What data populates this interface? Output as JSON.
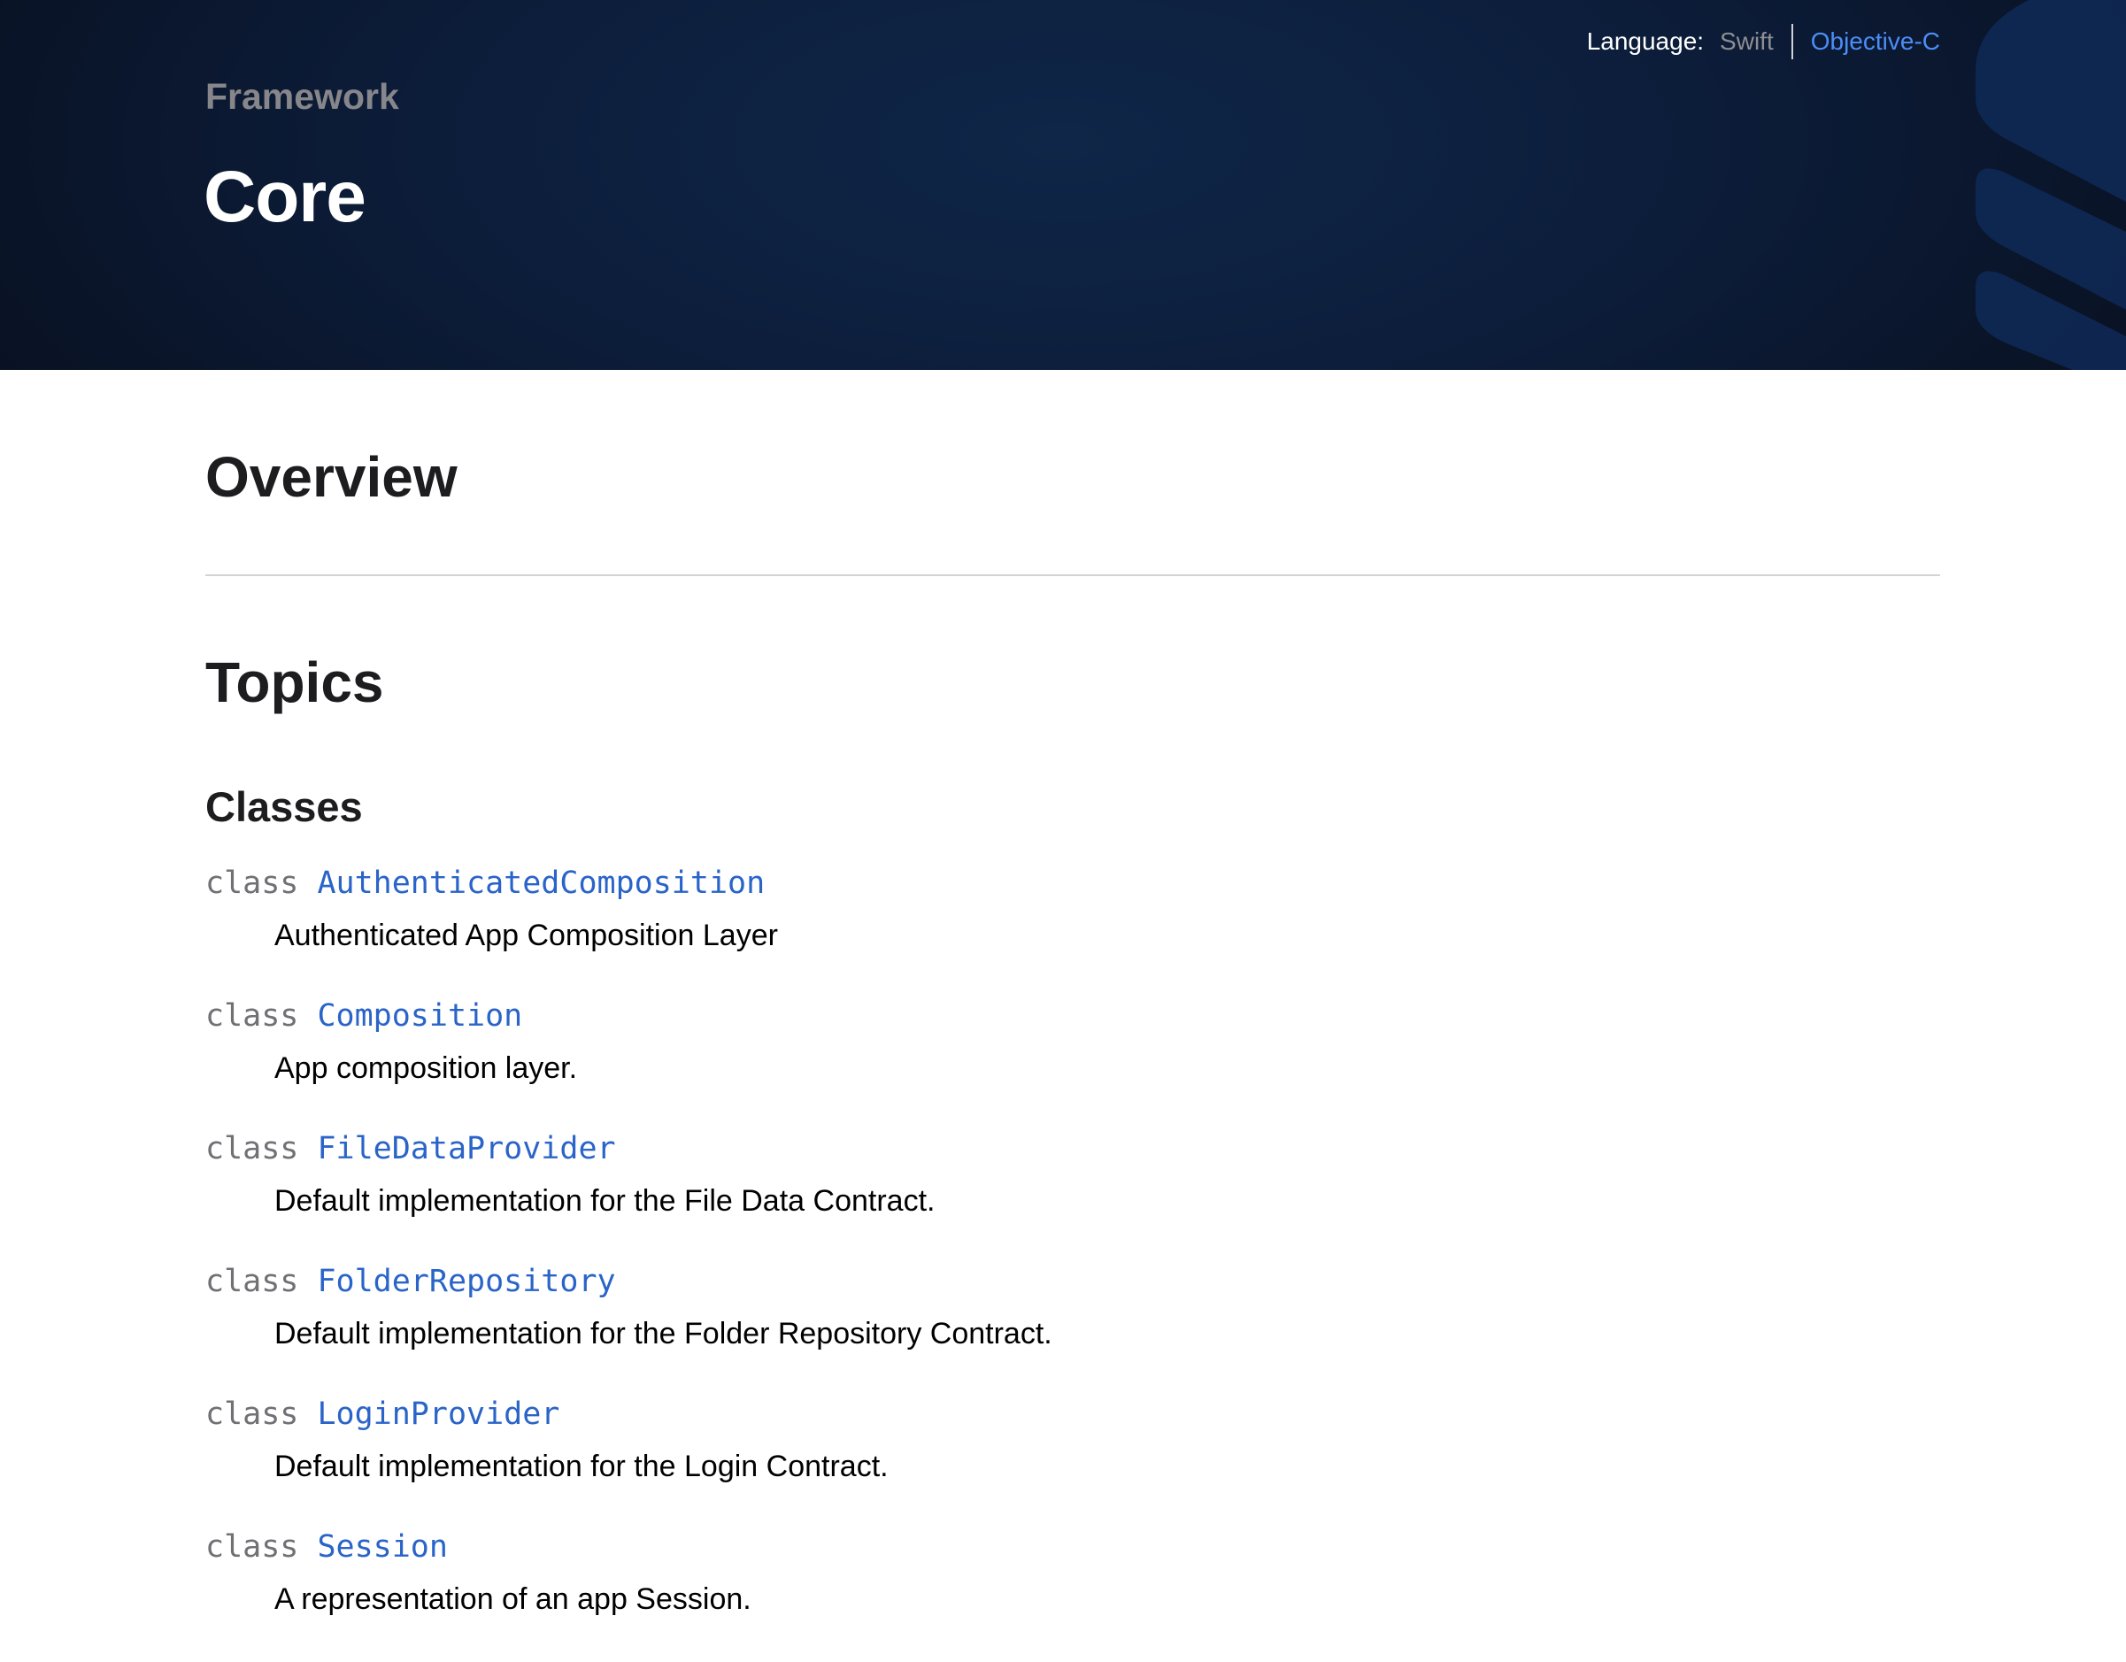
{
  "hero": {
    "eyebrow": "Framework",
    "title": "Core",
    "language_switch": {
      "label": "Language:",
      "options": [
        "Swift",
        "Objective-C"
      ],
      "selected": "Objective-C"
    },
    "colors": {
      "background": "#0c1d3a",
      "active_language": "#4c8df6",
      "inactive_language": "#8e8e93"
    }
  },
  "main": {
    "overview_heading": "Overview",
    "topics_heading": "Topics",
    "classes_heading": "Classes",
    "classes": [
      {
        "keyword": "class",
        "name": "AuthenticatedComposition",
        "description": "Authenticated App Composition Layer"
      },
      {
        "keyword": "class",
        "name": "Composition",
        "description": "App composition layer."
      },
      {
        "keyword": "class",
        "name": "FileDataProvider",
        "description": "Default implementation for the File Data Contract."
      },
      {
        "keyword": "class",
        "name": "FolderRepository",
        "description": "Default implementation for the Folder Repository Contract."
      },
      {
        "keyword": "class",
        "name": "LoginProvider",
        "description": "Default implementation for the Login Contract."
      },
      {
        "keyword": "class",
        "name": "Session",
        "description": "A representation of an app Session."
      }
    ],
    "colors": {
      "link": "#2a64c8",
      "keyword": "#707075"
    }
  }
}
